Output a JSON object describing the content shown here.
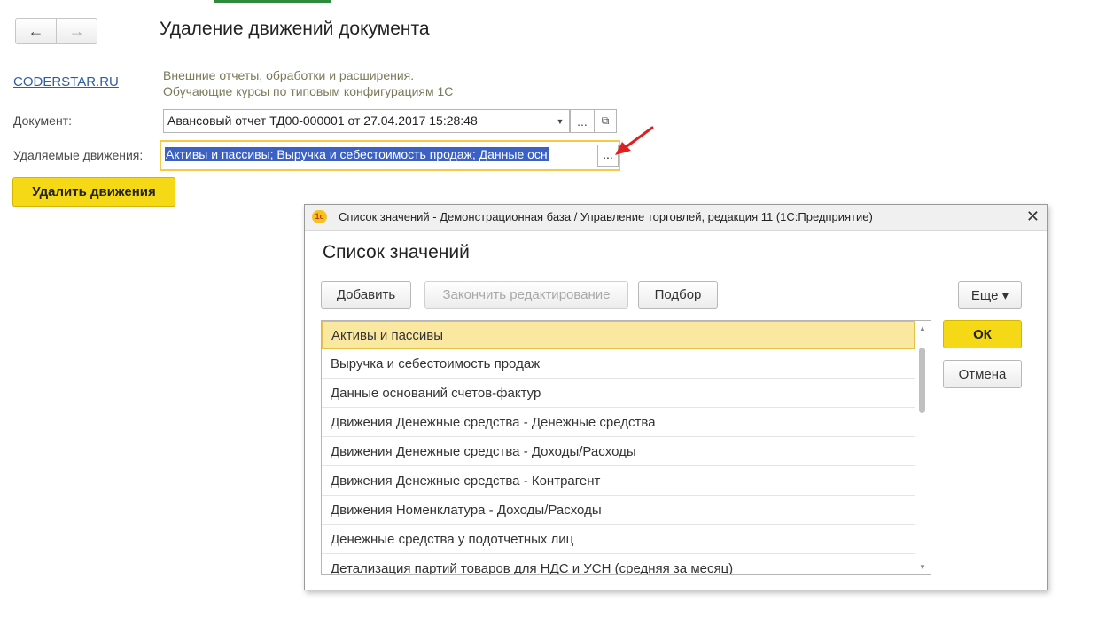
{
  "page": {
    "title": "Удаление движений документа",
    "site_link": "CODERSTAR.RU",
    "promo_line1": "Внешние отчеты, обработки и расширения.",
    "promo_line2": "Обучающие курсы по типовым конфигурациям 1С",
    "nav_back": "←",
    "nav_forward": "→"
  },
  "form": {
    "document_label": "Документ:",
    "document_value": "Авансовый отчет ТД00-000001 от 27.04.2017 15:28:48",
    "dropdown_glyph": "▼",
    "select_glyph": "...",
    "open_glyph": "⧉",
    "movements_label": "Удаляемые движения:",
    "movements_value": "Активы и пассивы; Выручка и себестоимость продаж; Данные осн",
    "movements_select_glyph": "...",
    "delete_button": "Удалить движения"
  },
  "dialog": {
    "window_title": "Список значений - Демонстрационная база / Управление торговлей, редакция 11  (1С:Предприятие)",
    "logo_text": "1с",
    "close_glyph": "✕",
    "heading": "Список значений",
    "toolbar": {
      "add": "Добавить",
      "finish_edit": "Закончить редактирование",
      "pick": "Подбор",
      "more": "Еще ▾"
    },
    "items": [
      "Активы и пассивы",
      "Выручка и себестоимость продаж",
      "Данные оснований счетов-фактур",
      "Движения Денежные средства - Денежные средства",
      "Движения Денежные средства - Доходы/Расходы",
      "Движения Денежные средства - Контрагент",
      "Движения Номенклатура - Доходы/Расходы",
      "Денежные средства у подотчетных лиц",
      "Детализация партий товаров для НДС и УСН (средняя за месяц)"
    ],
    "selected_index": 0,
    "ok": "ОК",
    "cancel": "Отмена",
    "scroll_up": "▲",
    "scroll_down": "▼"
  },
  "colors": {
    "accent_yellow": "#f5d916",
    "selection_blue": "#3b61c4",
    "row_selected": "#fbe8a0",
    "focus_border": "#f5c94a",
    "link": "#2f5e9e",
    "arrow": "#e02020"
  }
}
